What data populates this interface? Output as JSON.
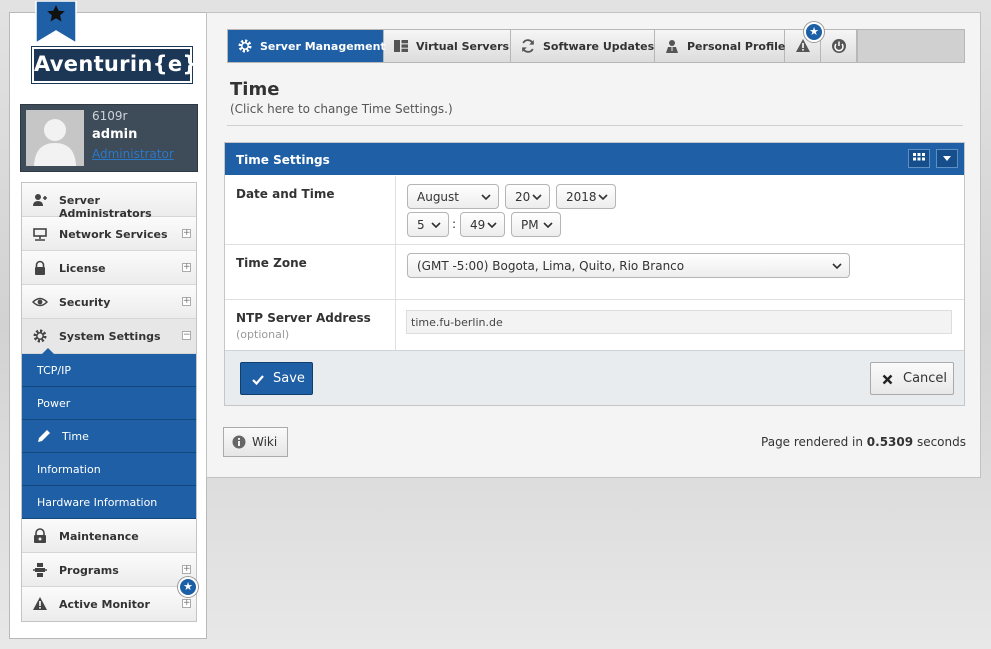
{
  "brand": {
    "logo_text": "Aventurin{e}"
  },
  "user": {
    "hostname": "6109r",
    "name": "admin",
    "role": "Administrator"
  },
  "sidebar": {
    "items": [
      {
        "label": "Server Administrators",
        "icon": "administrators-icon"
      },
      {
        "label": "Network Services",
        "icon": "network-icon",
        "toggle": "+"
      },
      {
        "label": "License",
        "icon": "license-icon",
        "toggle": "+"
      },
      {
        "label": "Security",
        "icon": "eye-icon",
        "toggle": "+"
      },
      {
        "label": "System Settings",
        "icon": "gear-icon",
        "toggle": "−",
        "expanded": true
      }
    ],
    "subitems": [
      "TCP/IP",
      "Power",
      "Time",
      "Information",
      "Hardware Information"
    ],
    "current_subitem": "Time",
    "items_after": [
      {
        "label": "Maintenance",
        "icon": "maintenance-icon"
      },
      {
        "label": "Programs",
        "icon": "programs-icon",
        "toggle": "+"
      },
      {
        "label": "Active Monitor",
        "icon": "warning-icon",
        "toggle": "+"
      }
    ],
    "badge": "★"
  },
  "tabs": [
    {
      "label": "Server Management",
      "icon": "gear-icon",
      "active": true
    },
    {
      "label": "Virtual Servers",
      "icon": "virtual-servers-icon"
    },
    {
      "label": "Software Updates",
      "icon": "refresh-icon"
    },
    {
      "label": "Personal Profile",
      "icon": "profile-icon"
    }
  ],
  "tab_badge": "★",
  "page": {
    "title": "Time",
    "subtitle": "(Click here to change Time Settings.)"
  },
  "panel": {
    "title": "Time Settings",
    "date_time_label": "Date and Time",
    "month": "August",
    "day": "20",
    "year": "2018",
    "hour": "5",
    "time_separator": ":",
    "minute": "49",
    "ampm": "PM",
    "timezone_label": "Time Zone",
    "timezone": "(GMT -5:00) Bogota, Lima, Quito, Rio Branco",
    "ntp_label": "NTP Server Address",
    "ntp_hint": "(optional)",
    "ntp_value": "time.fu-berlin.de",
    "save_label": "Save",
    "cancel_label": "Cancel"
  },
  "footer": {
    "wiki_label": "Wiki",
    "render_prefix": "Page rendered in",
    "render_time": "0.5309",
    "render_suffix": "seconds"
  },
  "colors": {
    "primary": "#1e5fa5",
    "brand_dark": "#1c3656",
    "user_card": "#3e4b59"
  }
}
